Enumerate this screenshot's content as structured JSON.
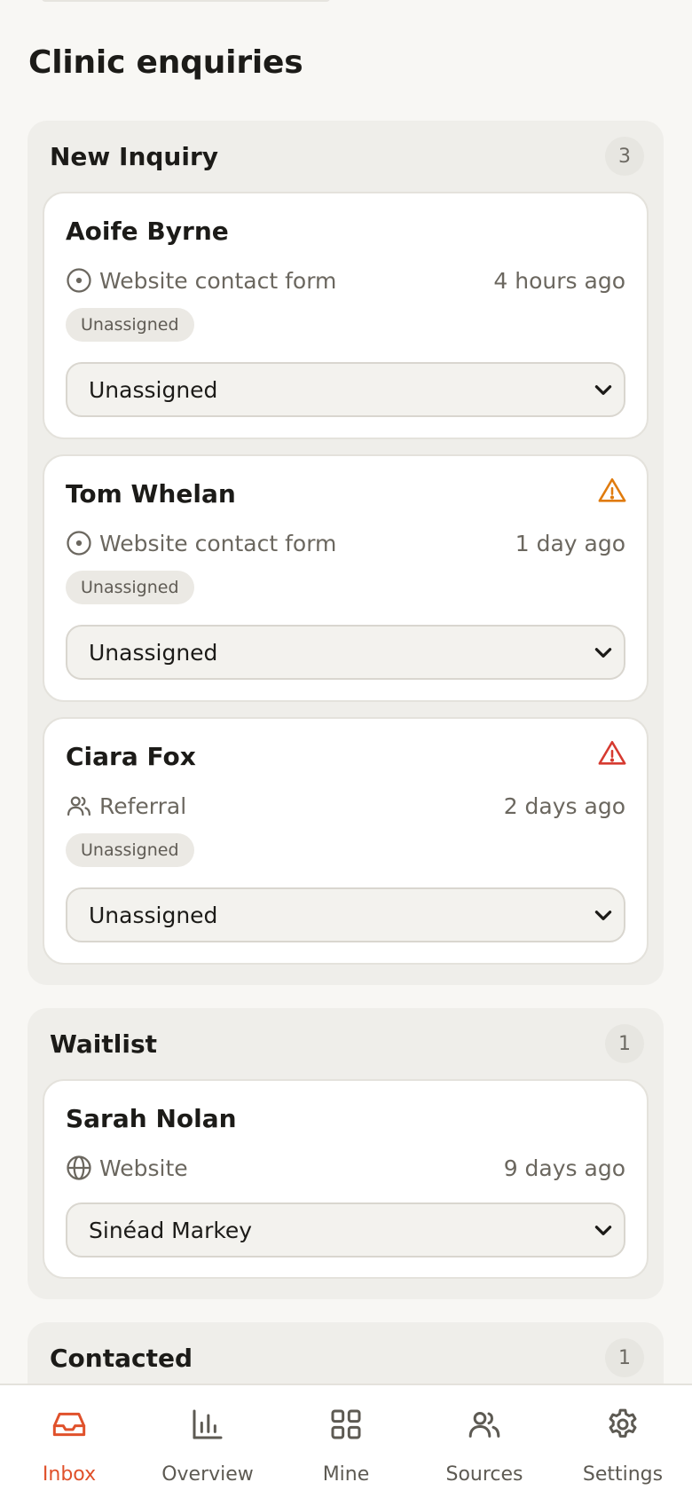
{
  "page": {
    "title": "Clinic enquiries"
  },
  "colors": {
    "accent": "#e0512b",
    "warning": "#e07b0d",
    "danger": "#d63a30"
  },
  "columns": [
    {
      "title": "New Inquiry",
      "count": "3",
      "cards": [
        {
          "name": "Aoife Byrne",
          "source": "Website contact form",
          "source_icon": "target-icon",
          "time": "4 hours ago",
          "badge": "Unassigned",
          "assignee": "Unassigned",
          "alert": null
        },
        {
          "name": "Tom Whelan",
          "source": "Website contact form",
          "source_icon": "target-icon",
          "time": "1 day ago",
          "badge": "Unassigned",
          "assignee": "Unassigned",
          "alert": "warning-icon"
        },
        {
          "name": "Ciara Fox",
          "source": "Referral",
          "source_icon": "users-icon",
          "time": "2 days ago",
          "badge": "Unassigned",
          "assignee": "Unassigned",
          "alert": "danger-icon"
        }
      ]
    },
    {
      "title": "Waitlist",
      "count": "1",
      "cards": [
        {
          "name": "Sarah Nolan",
          "source": "Website",
          "source_icon": "globe-icon",
          "time": "9 days ago",
          "assignee": "Sinéad Markey"
        }
      ]
    },
    {
      "title": "Contacted",
      "count": "1"
    }
  ],
  "nav": [
    {
      "label": "Inbox",
      "icon": "inbox-icon",
      "active": true
    },
    {
      "label": "Overview",
      "icon": "bar-chart-icon"
    },
    {
      "label": "Mine",
      "icon": "grid-icon"
    },
    {
      "label": "Sources",
      "icon": "users-icon"
    },
    {
      "label": "Settings",
      "icon": "gear-icon"
    }
  ]
}
